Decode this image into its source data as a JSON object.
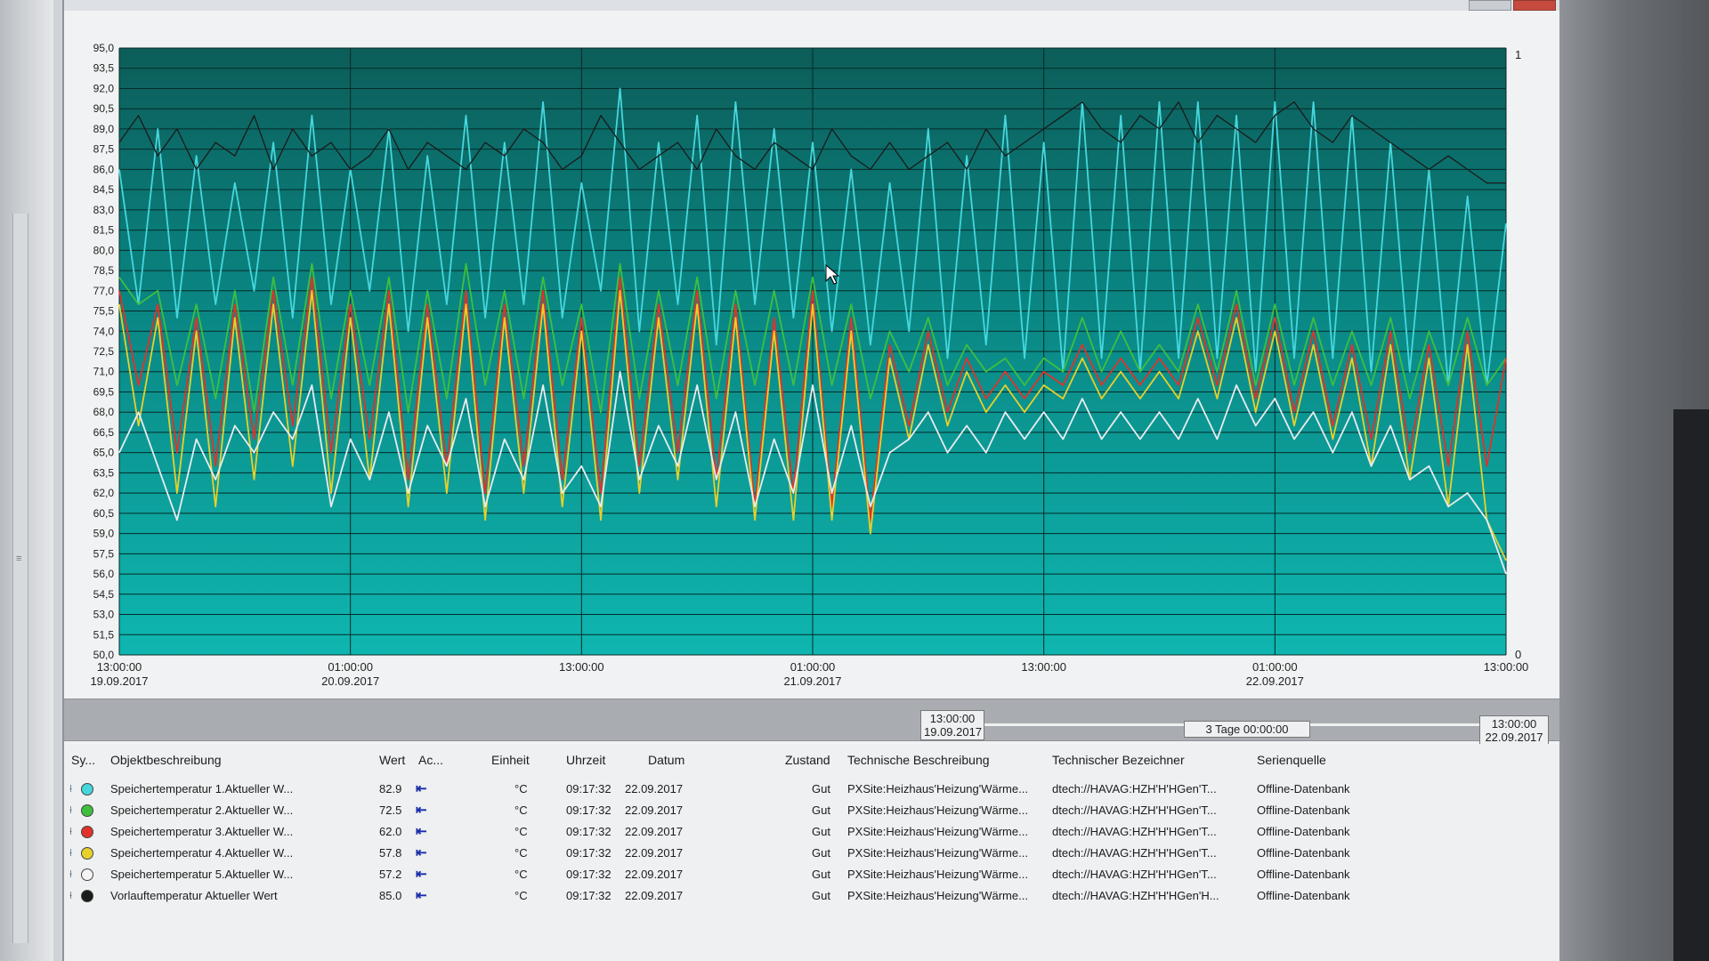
{
  "window": {
    "right_axis_top": "1",
    "right_axis_bottom": "0"
  },
  "chart_data": {
    "type": "line",
    "title": "",
    "xlabel": "",
    "ylabel": "",
    "ylim": [
      50.0,
      95.0
    ],
    "y_ticks": [
      "95,0",
      "93,5",
      "92,0",
      "90,5",
      "89,0",
      "87,5",
      "86,0",
      "84,5",
      "83,0",
      "81,5",
      "80,0",
      "78,5",
      "77,0",
      "75,5",
      "74,0",
      "72,5",
      "71,0",
      "69,5",
      "68,0",
      "66,5",
      "65,0",
      "63,5",
      "62,0",
      "60,5",
      "59,0",
      "57,5",
      "56,0",
      "54,5",
      "53,0",
      "51,5",
      "50,0"
    ],
    "x_range_hours": [
      0,
      72
    ],
    "x_ticks": [
      {
        "time": "13:00:00",
        "date": "19.09.2017",
        "h": 0
      },
      {
        "time": "01:00:00",
        "date": "20.09.2017",
        "h": 12
      },
      {
        "time": "13:00:00",
        "date": "",
        "h": 24
      },
      {
        "time": "01:00:00",
        "date": "21.09.2017",
        "h": 36
      },
      {
        "time": "13:00:00",
        "date": "",
        "h": 48
      },
      {
        "time": "01:00:00",
        "date": "22.09.2017",
        "h": 60
      },
      {
        "time": "13:00:00",
        "date": "",
        "h": 72
      }
    ],
    "grid": true,
    "series": [
      {
        "key": "s1",
        "color": "#46d6dc",
        "x": [
          0,
          1,
          2,
          3,
          4,
          5,
          6,
          7,
          8,
          9,
          10,
          11,
          12,
          13,
          14,
          15,
          16,
          17,
          18,
          19,
          20,
          21,
          22,
          23,
          24,
          25,
          26,
          27,
          28,
          29,
          30,
          31,
          32,
          33,
          34,
          35,
          36,
          37,
          38,
          39,
          40,
          41,
          42,
          43,
          44,
          45,
          46,
          47,
          48,
          49,
          50,
          51,
          52,
          53,
          54,
          55,
          56,
          57,
          58,
          59,
          60,
          61,
          62,
          63,
          64,
          65,
          66,
          67,
          68,
          69,
          70,
          71,
          72
        ],
        "values": [
          86,
          76,
          89,
          75,
          87,
          76,
          85,
          77,
          88,
          75,
          90,
          76,
          86,
          77,
          89,
          74,
          87,
          76,
          90,
          75,
          88,
          76,
          91,
          75,
          85,
          77,
          92,
          74,
          88,
          76,
          90,
          73,
          91,
          76,
          89,
          75,
          88,
          74,
          86,
          73,
          85,
          74,
          89,
          72,
          87,
          73,
          90,
          72,
          88,
          71,
          91,
          72,
          90,
          71,
          91,
          72,
          91,
          72,
          90,
          71,
          91,
          72,
          91,
          72,
          90,
          71,
          88,
          71,
          86,
          70,
          84,
          70,
          82
        ]
      },
      {
        "key": "s2",
        "color": "#3fbf3f",
        "x": [
          0,
          1,
          2,
          3,
          4,
          5,
          6,
          7,
          8,
          9,
          10,
          11,
          12,
          13,
          14,
          15,
          16,
          17,
          18,
          19,
          20,
          21,
          22,
          23,
          24,
          25,
          26,
          27,
          28,
          29,
          30,
          31,
          32,
          33,
          34,
          35,
          36,
          37,
          38,
          39,
          40,
          41,
          42,
          43,
          44,
          45,
          46,
          47,
          48,
          49,
          50,
          51,
          52,
          53,
          54,
          55,
          56,
          57,
          58,
          59,
          60,
          61,
          62,
          63,
          64,
          65,
          66,
          67,
          68,
          69,
          70,
          71,
          72
        ],
        "values": [
          78,
          76,
          77,
          70,
          76,
          69,
          77,
          68,
          78,
          70,
          79,
          69,
          77,
          70,
          78,
          68,
          77,
          69,
          79,
          70,
          77,
          69,
          78,
          70,
          76,
          68,
          79,
          69,
          77,
          70,
          78,
          69,
          77,
          70,
          77,
          70,
          78,
          70,
          76,
          69,
          74,
          71,
          75,
          70,
          73,
          71,
          72,
          70,
          72,
          71,
          75,
          71,
          74,
          71,
          73,
          71,
          76,
          71,
          77,
          70,
          76,
          70,
          75,
          70,
          74,
          70,
          75,
          69,
          74,
          70,
          75,
          70,
          72
        ]
      },
      {
        "key": "s3",
        "color": "#e0322a",
        "x": [
          0,
          1,
          2,
          3,
          4,
          5,
          6,
          7,
          8,
          9,
          10,
          11,
          12,
          13,
          14,
          15,
          16,
          17,
          18,
          19,
          20,
          21,
          22,
          23,
          24,
          25,
          26,
          27,
          28,
          29,
          30,
          31,
          32,
          33,
          34,
          35,
          36,
          37,
          38,
          39,
          40,
          41,
          42,
          43,
          44,
          45,
          46,
          47,
          48,
          49,
          50,
          51,
          52,
          53,
          54,
          55,
          56,
          57,
          58,
          59,
          60,
          61,
          62,
          63,
          64,
          65,
          66,
          67,
          68,
          69,
          70,
          71,
          72
        ],
        "values": [
          77,
          70,
          76,
          65,
          75,
          64,
          76,
          66,
          77,
          67,
          78,
          65,
          76,
          66,
          77,
          63,
          76,
          64,
          77,
          62,
          76,
          64,
          77,
          63,
          75,
          62,
          78,
          64,
          76,
          65,
          77,
          63,
          76,
          61,
          75,
          62,
          77,
          61,
          75,
          60,
          73,
          67,
          74,
          68,
          72,
          69,
          71,
          69,
          71,
          70,
          73,
          70,
          72,
          70,
          72,
          70,
          75,
          70,
          76,
          69,
          75,
          68,
          74,
          67,
          73,
          66,
          74,
          65,
          73,
          64,
          74,
          64,
          72
        ]
      },
      {
        "key": "s4",
        "color": "#e8d02a",
        "x": [
          0,
          1,
          2,
          3,
          4,
          5,
          6,
          7,
          8,
          9,
          10,
          11,
          12,
          13,
          14,
          15,
          16,
          17,
          18,
          19,
          20,
          21,
          22,
          23,
          24,
          25,
          26,
          27,
          28,
          29,
          30,
          31,
          32,
          33,
          34,
          35,
          36,
          37,
          38,
          39,
          40,
          41,
          42,
          43,
          44,
          45,
          46,
          47,
          48,
          49,
          50,
          51,
          52,
          53,
          54,
          55,
          56,
          57,
          58,
          59,
          60,
          61,
          62,
          63,
          64,
          65,
          66,
          67,
          68,
          69,
          70,
          71,
          72
        ],
        "values": [
          76,
          67,
          75,
          62,
          74,
          61,
          75,
          63,
          76,
          64,
          77,
          62,
          75,
          63,
          76,
          61,
          75,
          62,
          76,
          60,
          75,
          62,
          76,
          61,
          74,
          60,
          77,
          62,
          75,
          63,
          76,
          61,
          75,
          60,
          74,
          60,
          76,
          60,
          74,
          59,
          72,
          66,
          73,
          67,
          71,
          68,
          70,
          68,
          70,
          69,
          72,
          69,
          71,
          69,
          71,
          69,
          74,
          69,
          75,
          68,
          74,
          67,
          73,
          66,
          72,
          64,
          73,
          63,
          72,
          61,
          73,
          60,
          57
        ]
      },
      {
        "key": "s5",
        "color": "#e8ecee",
        "x": [
          0,
          1,
          2,
          3,
          4,
          5,
          6,
          7,
          8,
          9,
          10,
          11,
          12,
          13,
          14,
          15,
          16,
          17,
          18,
          19,
          20,
          21,
          22,
          23,
          24,
          25,
          26,
          27,
          28,
          29,
          30,
          31,
          32,
          33,
          34,
          35,
          36,
          37,
          38,
          39,
          40,
          41,
          42,
          43,
          44,
          45,
          46,
          47,
          48,
          49,
          50,
          51,
          52,
          53,
          54,
          55,
          56,
          57,
          58,
          59,
          60,
          61,
          62,
          63,
          64,
          65,
          66,
          67,
          68,
          69,
          70,
          71,
          72
        ],
        "values": [
          65,
          68,
          64,
          60,
          66,
          63,
          67,
          65,
          68,
          66,
          70,
          61,
          66,
          63,
          68,
          62,
          67,
          64,
          69,
          61,
          66,
          63,
          70,
          62,
          64,
          61,
          71,
          63,
          67,
          64,
          70,
          63,
          68,
          61,
          66,
          62,
          70,
          62,
          67,
          61,
          65,
          66,
          68,
          65,
          67,
          65,
          68,
          66,
          68,
          66,
          69,
          66,
          68,
          66,
          68,
          66,
          69,
          66,
          70,
          67,
          69,
          66,
          68,
          65,
          68,
          64,
          67,
          63,
          64,
          61,
          62,
          60,
          56
        ]
      },
      {
        "key": "s6",
        "color": "#1a1a1a",
        "x": [
          0,
          1,
          2,
          3,
          4,
          5,
          6,
          7,
          8,
          9,
          10,
          11,
          12,
          13,
          14,
          15,
          16,
          17,
          18,
          19,
          20,
          21,
          22,
          23,
          24,
          25,
          26,
          27,
          28,
          29,
          30,
          31,
          32,
          33,
          34,
          35,
          36,
          37,
          38,
          39,
          40,
          41,
          42,
          43,
          44,
          45,
          46,
          47,
          48,
          49,
          50,
          51,
          52,
          53,
          54,
          55,
          56,
          57,
          58,
          59,
          60,
          61,
          62,
          63,
          64,
          65,
          66,
          67,
          68,
          69,
          70,
          71,
          72
        ],
        "values": [
          88,
          90,
          87,
          89,
          86,
          88,
          87,
          90,
          86,
          89,
          87,
          88,
          86,
          87,
          89,
          86,
          88,
          87,
          86,
          88,
          87,
          89,
          88,
          86,
          87,
          90,
          88,
          86,
          87,
          88,
          86,
          89,
          87,
          86,
          88,
          87,
          86,
          89,
          87,
          86,
          88,
          86,
          87,
          88,
          86,
          89,
          87,
          88,
          89,
          90,
          91,
          89,
          88,
          90,
          89,
          91,
          88,
          90,
          89,
          88,
          90,
          91,
          89,
          88,
          90,
          89,
          88,
          87,
          86,
          87,
          86,
          85,
          85
        ]
      }
    ]
  },
  "range": {
    "start_time": "13:00:00",
    "start_date": "19.09.2017",
    "duration": "3 Tage 00:00:00",
    "end_time": "13:00:00",
    "end_date": "22.09.2017"
  },
  "table": {
    "headers": [
      "Sy...",
      "Objektbeschreibung",
      "Wert",
      "Ac...",
      "Einheit",
      "Uhrzeit",
      "Datum",
      "Zustand",
      "Technische Beschreibung",
      "Technischer Bezeichner",
      "Serienquelle"
    ],
    "rows": [
      {
        "color": "#46d6dc",
        "desc": "Speichertemperatur 1.Aktueller W...",
        "wert": "82.9",
        "einheit": "°C",
        "uhrzeit": "09:17:32",
        "datum": "22.09.2017",
        "zustand": "Gut",
        "tech_desc": "PXSite:Heizhaus'Heizung'Wärme...",
        "tech_id": "dtech://HAVAG:HZH'H'HGen'T...",
        "quelle": "Offline-Datenbank"
      },
      {
        "color": "#3fbf3f",
        "desc": "Speichertemperatur 2.Aktueller W...",
        "wert": "72.5",
        "einheit": "°C",
        "uhrzeit": "09:17:32",
        "datum": "22.09.2017",
        "zustand": "Gut",
        "tech_desc": "PXSite:Heizhaus'Heizung'Wärme...",
        "tech_id": "dtech://HAVAG:HZH'H'HGen'T...",
        "quelle": "Offline-Datenbank"
      },
      {
        "color": "#e0322a",
        "desc": "Speichertemperatur 3.Aktueller W...",
        "wert": "62.0",
        "einheit": "°C",
        "uhrzeit": "09:17:32",
        "datum": "22.09.2017",
        "zustand": "Gut",
        "tech_desc": "PXSite:Heizhaus'Heizung'Wärme...",
        "tech_id": "dtech://HAVAG:HZH'H'HGen'T...",
        "quelle": "Offline-Datenbank"
      },
      {
        "color": "#e8d02a",
        "desc": "Speichertemperatur 4.Aktueller W...",
        "wert": "57.8",
        "einheit": "°C",
        "uhrzeit": "09:17:32",
        "datum": "22.09.2017",
        "zustand": "Gut",
        "tech_desc": "PXSite:Heizhaus'Heizung'Wärme...",
        "tech_id": "dtech://HAVAG:HZH'H'HGen'T...",
        "quelle": "Offline-Datenbank"
      },
      {
        "color": "#f4f4f4",
        "desc": "Speichertemperatur 5.Aktueller W...",
        "wert": "57.2",
        "einheit": "°C",
        "uhrzeit": "09:17:32",
        "datum": "22.09.2017",
        "zustand": "Gut",
        "tech_desc": "PXSite:Heizhaus'Heizung'Wärme...",
        "tech_id": "dtech://HAVAG:HZH'H'HGen'T...",
        "quelle": "Offline-Datenbank"
      },
      {
        "color": "#1a1a1a",
        "desc": "Vorlauftemperatur Aktueller Wert",
        "wert": "85.0",
        "einheit": "°C",
        "uhrzeit": "09:17:32",
        "datum": "22.09.2017",
        "zustand": "Gut",
        "tech_desc": "PXSite:Heizhaus'Heizung'Wärme...",
        "tech_id": "dtech://HAVAG:HZH'H'HGen'H...",
        "quelle": "Offline-Datenbank"
      }
    ]
  },
  "icons": {
    "pin": "pin-icon",
    "action": "arrow-to-left-icon"
  }
}
